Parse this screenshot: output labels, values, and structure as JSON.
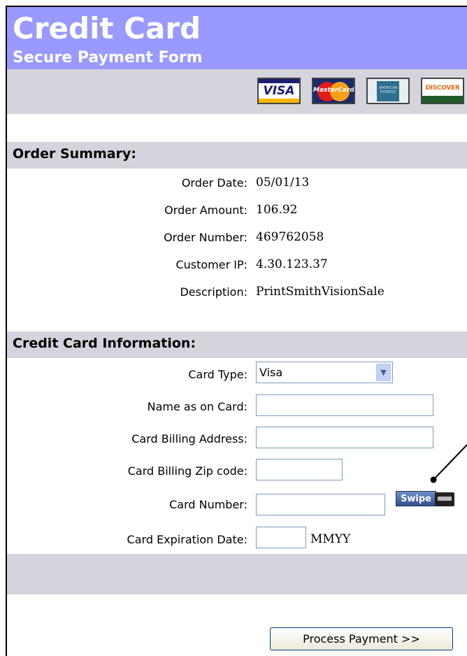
{
  "header": {
    "title": "Credit Card",
    "subtitle": "Secure Payment Form"
  },
  "card_logos": [
    {
      "name": "visa-logo",
      "text": "VISA"
    },
    {
      "name": "mastercard-logo",
      "text": "MasterCard"
    },
    {
      "name": "amex-logo",
      "text": "AMERICAN EXPRESS"
    },
    {
      "name": "discover-logo",
      "text": "DISCOVER"
    }
  ],
  "order_summary": {
    "heading": "Order Summary:",
    "rows": [
      {
        "label": "Order Date:",
        "value": "05/01/13"
      },
      {
        "label": "Order Amount:",
        "value": "106.92"
      },
      {
        "label": "Order Number:",
        "value": "469762058"
      },
      {
        "label": "Customer IP:",
        "value": "4.30.123.37"
      },
      {
        "label": "Description:",
        "value": "PrintSmithVisionSale"
      }
    ]
  },
  "card_info": {
    "heading": "Credit Card Information:",
    "card_type_label": "Card Type:",
    "card_type_value": "Visa",
    "name_label": "Name as on Card:",
    "name_value": "",
    "address_label": "Card Billing Address:",
    "address_value": "",
    "zip_label": "Card Billing Zip code:",
    "zip_value": "",
    "number_label": "Card Number:",
    "number_value": "",
    "swipe_label": "Swipe",
    "expiration_label": "Card Expiration Date:",
    "expiration_value": "",
    "expiration_format": "MMYY"
  },
  "actions": {
    "process_label": "Process Payment >>"
  },
  "colors": {
    "header_bg": "#9999ff",
    "bar_bg": "#d4d4dc"
  }
}
